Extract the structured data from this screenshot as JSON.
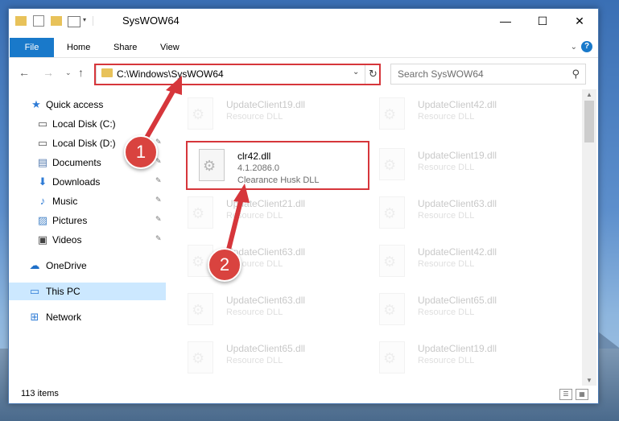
{
  "window": {
    "title": "SysWOW64",
    "controls": {
      "minimize": "—",
      "maximize": "☐",
      "close": "✕"
    }
  },
  "ribbon": {
    "file": "File",
    "tabs": [
      "Home",
      "Share",
      "View"
    ],
    "help": "?"
  },
  "nav": {
    "address": "C:\\Windows\\SysWOW64",
    "search_placeholder": "Search SysWOW64"
  },
  "sidebar": {
    "items": [
      {
        "label": "Quick access",
        "icon": "star-icon",
        "pinned": false
      },
      {
        "label": "Local Disk (C:)",
        "icon": "drive-icon",
        "pinned": false
      },
      {
        "label": "Local Disk (D:)",
        "icon": "drive-icon",
        "pinned": true
      },
      {
        "label": "Documents",
        "icon": "documents-icon",
        "pinned": true
      },
      {
        "label": "Downloads",
        "icon": "download-icon",
        "pinned": true
      },
      {
        "label": "Music",
        "icon": "music-icon",
        "pinned": true
      },
      {
        "label": "Pictures",
        "icon": "pictures-icon",
        "pinned": true
      },
      {
        "label": "Videos",
        "icon": "videos-icon",
        "pinned": true
      },
      {
        "label": "OneDrive",
        "icon": "cloud-icon",
        "pinned": false
      },
      {
        "label": "This PC",
        "icon": "computer-icon",
        "pinned": false,
        "selected": true
      },
      {
        "label": "Network",
        "icon": "network-icon",
        "pinned": false
      }
    ]
  },
  "files": {
    "highlighted": {
      "name": "clr42.dll",
      "version": "4.1.2086.0",
      "description": "Clearance Husk DLL"
    },
    "left_column": [
      {
        "name": "UpdateClient19.dll",
        "description": "Resource DLL"
      },
      {
        "name": "UpdateClient21.dll",
        "description": "Resource DLL"
      },
      {
        "name": "UpdateClient63.dll",
        "description": "Resource DLL"
      },
      {
        "name": "UpdateClient63.dll",
        "description": "Resource DLL"
      },
      {
        "name": "UpdateClient65.dll",
        "description": "Resource DLL"
      }
    ],
    "right_column": [
      {
        "name": "UpdateClient42.dll",
        "description": "Resource DLL"
      },
      {
        "name": "UpdateClient19.dll",
        "description": "Resource DLL"
      },
      {
        "name": "UpdateClient63.dll",
        "description": "Resource DLL"
      },
      {
        "name": "UpdateClient42.dll",
        "description": "Resource DLL"
      },
      {
        "name": "UpdateClient65.dll",
        "description": "Resource DLL"
      },
      {
        "name": "UpdateClient19.dll",
        "description": "Resource DLL"
      }
    ]
  },
  "status": {
    "item_count": "113 items"
  },
  "annotations": {
    "step1": "1",
    "step2": "2",
    "color": "#d6363b"
  }
}
